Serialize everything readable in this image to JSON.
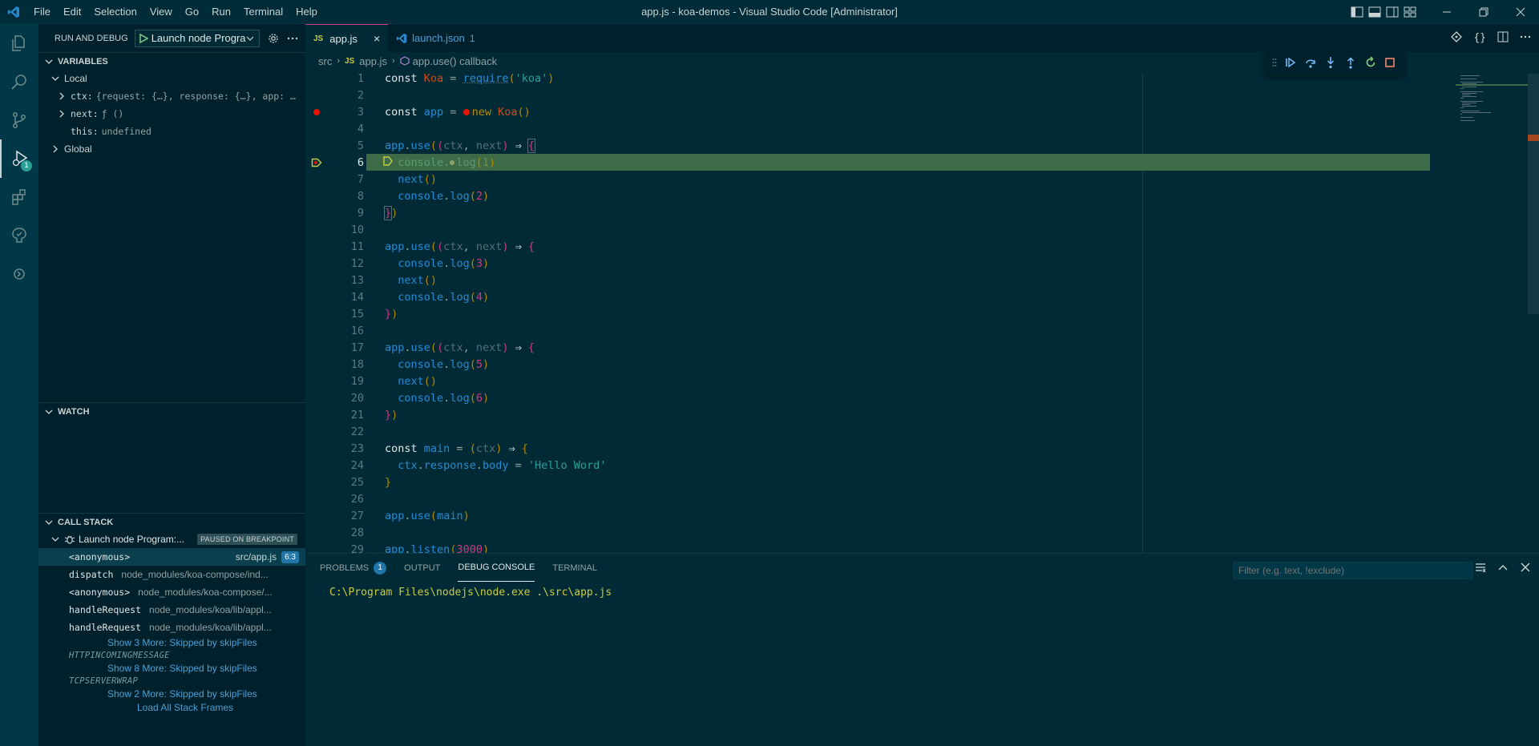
{
  "titlebar": {
    "menu": [
      "File",
      "Edit",
      "Selection",
      "View",
      "Go",
      "Run",
      "Terminal",
      "Help"
    ],
    "window_title": "app.js - koa-demos - Visual Studio Code [Administrator]"
  },
  "activitybar": {
    "debug_badge": "1"
  },
  "sidebar": {
    "title": "RUN AND DEBUG",
    "config_name": "Launch node Program",
    "variables": {
      "header": "VARIABLES",
      "local": "Local",
      "items": [
        {
          "name": "ctx:",
          "value": "{request: {…}, response: {…}, app: …"
        },
        {
          "name": "next:",
          "value": "ƒ ()"
        },
        {
          "name": "this:",
          "value": "undefined"
        }
      ],
      "global": "Global"
    },
    "watch": {
      "header": "WATCH"
    },
    "callstack": {
      "header": "CALL STACK",
      "session": "Launch node Program:...",
      "status": "PAUSED ON BREAKPOINT",
      "frames": [
        {
          "fn": "<anonymous>",
          "file": "src/app.js",
          "pos": "6:3"
        },
        {
          "fn": "dispatch",
          "file": "node_modules/koa-compose/ind..."
        },
        {
          "fn": "<anonymous>",
          "file": "node_modules/koa-compose/..."
        },
        {
          "fn": "handleRequest",
          "file": "node_modules/koa/lib/appl..."
        },
        {
          "fn": "handleRequest",
          "file": "node_modules/koa/lib/appl..."
        }
      ],
      "skip1": "Show 3 More: Skipped by skipFiles",
      "origin1": "HTTPINCOMINGMESSAGE",
      "skip2": "Show 8 More: Skipped by skipFiles",
      "origin2": "TCPSERVERWRAP",
      "skip3": "Show 2 More: Skipped by skipFiles",
      "load_all": "Load All Stack Frames"
    }
  },
  "editor": {
    "tabs": [
      {
        "icon": "JS",
        "label": "app.js",
        "close": "×"
      },
      {
        "label": "launch.json",
        "suffix": "1"
      }
    ],
    "breadcrumb": {
      "folder": "src",
      "file_icon": "JS",
      "file": "app.js",
      "symbol": "app.use() callback"
    },
    "current_line": 6,
    "lines": [
      {
        "n": "1"
      },
      {
        "n": "2"
      },
      {
        "n": "3"
      },
      {
        "n": "4"
      },
      {
        "n": "5"
      },
      {
        "n": "6"
      },
      {
        "n": "7"
      },
      {
        "n": "8"
      },
      {
        "n": "9"
      },
      {
        "n": "10"
      },
      {
        "n": "11"
      },
      {
        "n": "12"
      },
      {
        "n": "13"
      },
      {
        "n": "14"
      },
      {
        "n": "15"
      },
      {
        "n": "16"
      },
      {
        "n": "17"
      },
      {
        "n": "18"
      },
      {
        "n": "19"
      },
      {
        "n": "20"
      },
      {
        "n": "21"
      },
      {
        "n": "22"
      },
      {
        "n": "23"
      },
      {
        "n": "24"
      },
      {
        "n": "25"
      },
      {
        "n": "26"
      },
      {
        "n": "27"
      },
      {
        "n": "28"
      },
      {
        "n": "29"
      }
    ],
    "code": {
      "l1": [
        "const",
        " ",
        "Koa",
        " = ",
        "require",
        "(",
        "'koa'",
        ")"
      ],
      "l3": [
        "const",
        " ",
        "app",
        " = ",
        "new",
        " ",
        "Koa",
        "()"
      ],
      "l5": [
        "app",
        ".",
        "use",
        "(",
        "(",
        "ctx",
        ", ",
        "next",
        ")",
        " ⇒ ",
        "{"
      ],
      "l6": [
        "  ",
        "console",
        ".",
        "log",
        "(",
        "1",
        ")"
      ],
      "l7": [
        "  ",
        "next",
        "()"
      ],
      "l8": [
        "  ",
        "console",
        ".",
        "log",
        "(",
        "2",
        ")"
      ],
      "l9": [
        "}",
        ")"
      ],
      "l11": [
        "app",
        ".",
        "use",
        "(",
        "(",
        "ctx",
        ", ",
        "next",
        ")",
        " ⇒ ",
        "{"
      ],
      "l12": [
        "  ",
        "console",
        ".",
        "log",
        "(",
        "3",
        ")"
      ],
      "l13": [
        "  ",
        "next",
        "()"
      ],
      "l14": [
        "  ",
        "console",
        ".",
        "log",
        "(",
        "4",
        ")"
      ],
      "l15": [
        "}",
        ")"
      ],
      "l17": [
        "app",
        ".",
        "use",
        "(",
        "(",
        "ctx",
        ", ",
        "next",
        ")",
        " ⇒ ",
        "{"
      ],
      "l18": [
        "  ",
        "console",
        ".",
        "log",
        "(",
        "5",
        ")"
      ],
      "l19": [
        "  ",
        "next",
        "()"
      ],
      "l20": [
        "  ",
        "console",
        ".",
        "log",
        "(",
        "6",
        ")"
      ],
      "l21": [
        "}",
        ")"
      ],
      "l23": [
        "const",
        " ",
        "main",
        " = ",
        "(",
        "ctx",
        ")",
        " ⇒ ",
        "{"
      ],
      "l24": [
        "  ",
        "ctx",
        ".",
        "response",
        ".",
        "body",
        " = ",
        "'Hello Word'"
      ],
      "l25": [
        "}"
      ],
      "l27": [
        "app",
        ".",
        "use",
        "(",
        "main",
        ")"
      ],
      "l29": [
        "app",
        ".",
        "listen",
        "(",
        "3000",
        ")"
      ]
    }
  },
  "panel": {
    "tabs": [
      "PROBLEMS",
      "OUTPUT",
      "DEBUG CONSOLE",
      "TERMINAL"
    ],
    "problems_count": "1",
    "filter_placeholder": "Filter (e.g. text, !exclude)",
    "output_line": "C:\\Program Files\\nodejs\\node.exe .\\src\\app.js"
  },
  "colors": {
    "background": "#002b36",
    "sidebar": "#00212b",
    "activitybar": "#003847",
    "current_line_highlight": "#3d6b48",
    "accent_blue": "#268bd2",
    "string": "#2aa198",
    "number": "#d33682",
    "class": "#cb4b16",
    "breakpoint": "#e51400"
  }
}
